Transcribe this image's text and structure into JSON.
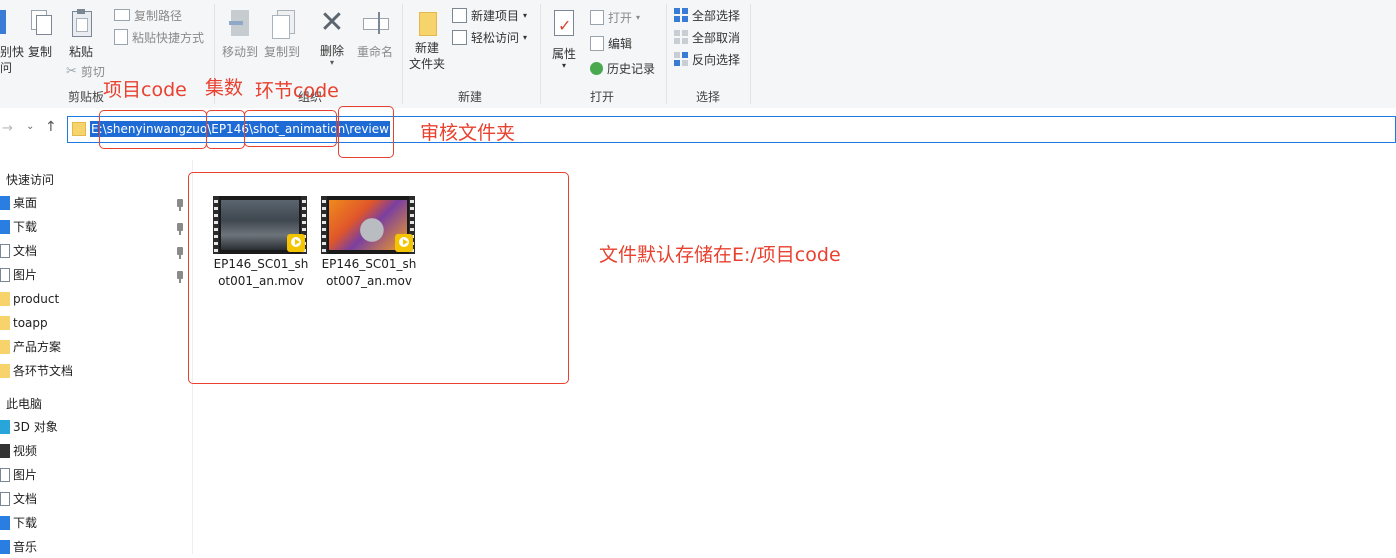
{
  "ribbon": {
    "clipboard": {
      "pin_partial": "别快",
      "pin_partial2": "问",
      "copy": "复制",
      "paste": "粘贴",
      "copy_path": "复制路径",
      "paste_shortcut": "粘贴快捷方式",
      "cut": "剪切",
      "group": "剪贴板"
    },
    "organize": {
      "move_to": "移动到",
      "copy_to": "复制到",
      "delete": "删除",
      "rename": "重命名",
      "group": "组织"
    },
    "new": {
      "new_folder_line1": "新建",
      "new_folder_line2": "文件夹",
      "new_item": "新建项目",
      "easy_access": "轻松访问",
      "group": "新建"
    },
    "open": {
      "properties": "属性",
      "open": "打开",
      "edit": "编辑",
      "history": "历史记录",
      "group": "打开"
    },
    "select": {
      "select_all": "全部选择",
      "select_none": "全部取消",
      "invert": "反向选择",
      "group": "选择"
    }
  },
  "address": {
    "path": "E:\\shenyinwangzuo\\EP146\\shot_animation\\review"
  },
  "nav": {
    "quick_access": "快速访问",
    "quick_items": [
      "桌面",
      "下载",
      "文档",
      "图片",
      "product",
      "toapp",
      "产品方案",
      "各环节文档"
    ],
    "this_pc": "此电脑",
    "pc_items": [
      "3D 对象",
      "视频",
      "图片",
      "文档",
      "下载",
      "音乐"
    ]
  },
  "files": [
    {
      "name": "EP146_SC01_shot001_an.mov",
      "line1": "EP146_SC01_sh",
      "line2": "ot001_an.mov"
    },
    {
      "name": "EP146_SC01_shot007_an.mov",
      "line1": "EP146_SC01_sh",
      "line2": "ot007_an.mov"
    }
  ],
  "badge_label": "Player",
  "annotations": {
    "project_code": "项目code",
    "episode": "集数",
    "stage_code": "环节code",
    "review_folder": "审核文件夹",
    "default_storage": "文件默认存储在E:/项目code"
  },
  "colors": {
    "annotation_red": "#e8412f",
    "selection_blue": "#1e6bd6",
    "ribbon_bg": "#f5f6f7",
    "folder_yellow": "#f6d36b"
  }
}
